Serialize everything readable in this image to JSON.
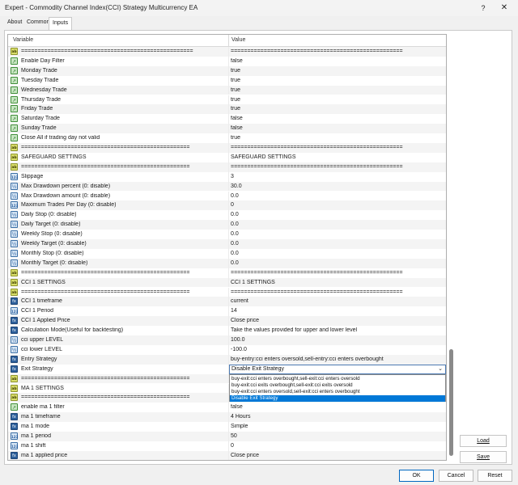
{
  "window": {
    "title": "Expert - Commodity Channel Index(CCI) Strategy Multicurrency EA",
    "help_label": "?",
    "close_label": "✕"
  },
  "tabs": [
    {
      "label": "About",
      "active": false
    },
    {
      "label": "Common",
      "active": false
    },
    {
      "label": "Inputs",
      "active": true
    }
  ],
  "grid": {
    "header": {
      "variable": "Variable",
      "value": "Value"
    },
    "rows": [
      {
        "icon": "ab",
        "name": "====================================================",
        "value": "===================================================="
      },
      {
        "icon": "tr",
        "name": "Enable Day Filter",
        "value": "false"
      },
      {
        "icon": "tr",
        "name": "Monday Trade",
        "value": "true"
      },
      {
        "icon": "tr",
        "name": "Tuesday Trade",
        "value": "true"
      },
      {
        "icon": "tr",
        "name": "Wednesday Trade",
        "value": "true"
      },
      {
        "icon": "tr",
        "name": "Thursday Trade",
        "value": "true"
      },
      {
        "icon": "tr",
        "name": "Friday Trade",
        "value": "true"
      },
      {
        "icon": "tr",
        "name": "Saturday Trade",
        "value": "false"
      },
      {
        "icon": "tr",
        "name": "Sunday Trade",
        "value": "false"
      },
      {
        "icon": "tr",
        "name": "Close All if trading day not valid",
        "value": "true"
      },
      {
        "icon": "ab",
        "name": "===================================================",
        "value": "===================================================="
      },
      {
        "icon": "ab",
        "name": "SAFEGUARD SETTINGS",
        "value": "SAFEGUARD SETTINGS"
      },
      {
        "icon": "ab",
        "name": "===================================================",
        "value": "===================================================="
      },
      {
        "icon": "n",
        "name": "Slippage",
        "value": "3"
      },
      {
        "icon": "v",
        "name": "Max Drawdown percent (0: disable)",
        "value": "30.0"
      },
      {
        "icon": "v",
        "name": "Max Drawdown amount (0: disable)",
        "value": "0.0"
      },
      {
        "icon": "n",
        "name": "Maximum Trades Per Day (0: disable)",
        "value": "0"
      },
      {
        "icon": "v",
        "name": "Daily Stop (0: disable)",
        "value": "0.0"
      },
      {
        "icon": "v",
        "name": "Daily Target (0: disable)",
        "value": "0.0"
      },
      {
        "icon": "v",
        "name": "Weekly Stop (0: disable)",
        "value": "0.0"
      },
      {
        "icon": "v",
        "name": "Weekly Target (0: disable)",
        "value": "0.0"
      },
      {
        "icon": "v",
        "name": "Monthly Stop (0: disable)",
        "value": "0.0"
      },
      {
        "icon": "v",
        "name": "Monthly Target (0: disable)",
        "value": "0.0"
      },
      {
        "icon": "ab",
        "name": "===================================================",
        "value": "===================================================="
      },
      {
        "icon": "ab",
        "name": "CCI 1 SETTINGS",
        "value": "CCI 1 SETTINGS"
      },
      {
        "icon": "ab",
        "name": "===================================================",
        "value": "===================================================="
      },
      {
        "icon": "fn",
        "name": "CCI 1 timeframe",
        "value": "current"
      },
      {
        "icon": "n",
        "name": "CCI 1 Period",
        "value": "14"
      },
      {
        "icon": "fn",
        "name": "CCI 1 Applied Price",
        "value": "Close price"
      },
      {
        "icon": "fn",
        "name": "Calculation Mode(Useful for backtesting)",
        "value": "Take the values provided for upper and lower level"
      },
      {
        "icon": "v",
        "name": "cci upper LEVEL",
        "value": "100.0"
      },
      {
        "icon": "v",
        "name": "cci lower LEVEL",
        "value": "-100.0"
      },
      {
        "icon": "fn",
        "name": "Entry Strategy",
        "value": "buy-entry:cci enters oversold,sell-entry:cci enters overbought"
      },
      {
        "icon": "fn",
        "name": "Exit Strategy",
        "value": ""
      },
      {
        "icon": "ab",
        "name": "===================================================",
        "value": ""
      },
      {
        "icon": "ab",
        "name": "MA 1 SETTINGS",
        "value": ""
      },
      {
        "icon": "ab",
        "name": "===================================================",
        "value": ""
      },
      {
        "icon": "tr",
        "name": "enable ma 1 filter",
        "value": "false"
      },
      {
        "icon": "fn",
        "name": "ma 1 timeframe",
        "value": "4 Hours"
      },
      {
        "icon": "fn",
        "name": "ma 1 mode",
        "value": "Simple"
      },
      {
        "icon": "n",
        "name": "ma 1 period",
        "value": "50"
      },
      {
        "icon": "n",
        "name": "ma 1 shift",
        "value": "0"
      },
      {
        "icon": "fn",
        "name": "ma 1 applied price",
        "value": "Close price"
      }
    ]
  },
  "exit_combo": {
    "selected": "Disable Exit Strategy",
    "chevron": "⌄",
    "options": [
      "buy-exit:cci enters overbought,sell-exit:cci enters oversold",
      "buy-exit:cci exits overbought,sell-exit:cci exits oversold",
      "buy-exit:cci enters oversold,sell-exit:cci enters overbought",
      "Disable Exit Strategy"
    ],
    "highlighted_index": 3
  },
  "side_buttons": {
    "load": "Load",
    "save": "Save"
  },
  "footer": {
    "ok": "OK",
    "cancel": "Cancel",
    "reset": "Reset"
  },
  "colors": {
    "selection": "#0078d7",
    "default_button_border": "#0067c0"
  }
}
